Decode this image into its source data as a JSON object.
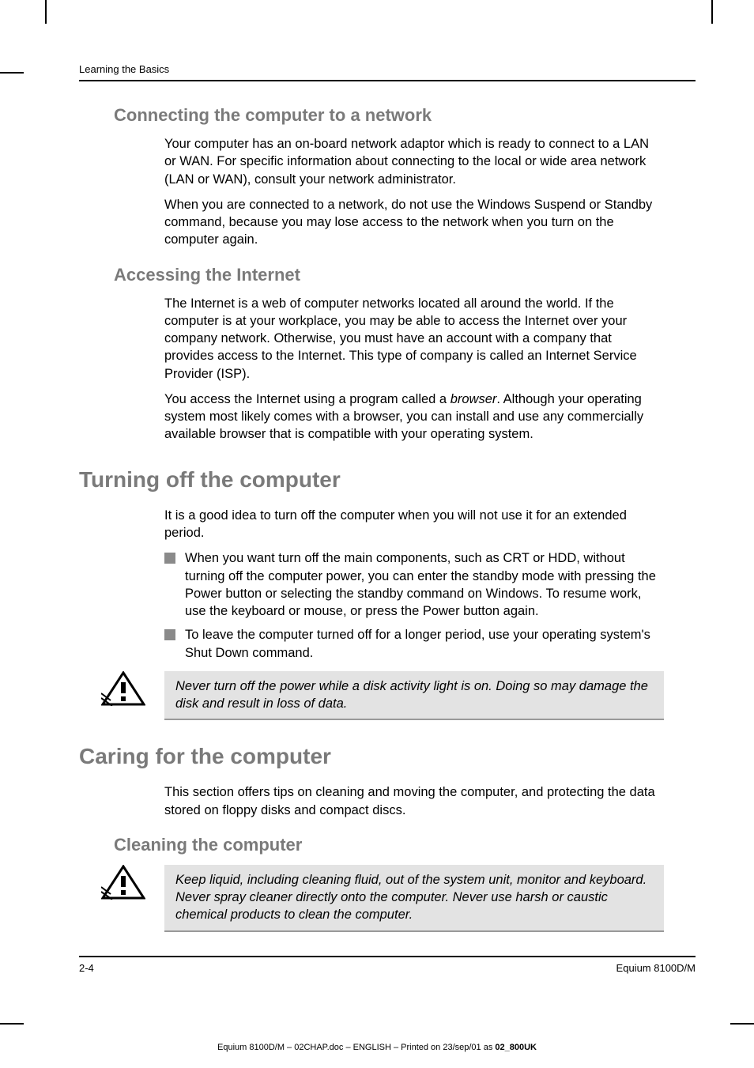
{
  "running_head": "Learning the Basics",
  "sections": {
    "s1": {
      "title": "Connecting the computer to a network",
      "p1": "Your computer has an on-board network adaptor which is ready to connect to a LAN or WAN. For specific information about connecting to the local or wide area network (LAN or WAN), consult your network administrator.",
      "p2": "When you are connected to a network, do not use the Windows Suspend or Standby command, because you may lose access to the network when you turn on the computer again."
    },
    "s2": {
      "title": "Accessing the Internet",
      "p1": "The Internet is a web of computer networks located all around the world. If the computer is at your workplace, you may be able to access the Internet over your company network. Otherwise, you must have an account with a company that provides access to the Internet. This type of company is called an Internet Service Provider (ISP).",
      "p2a": "You access the Internet using a program called a ",
      "p2b": "browser",
      "p2c": ". Although your operating system most likely comes with a browser, you can install and use any commercially available browser that is compatible with your operating system."
    },
    "s3": {
      "title": "Turning off the computer",
      "p1": "It is a good idea to turn off the computer when you will not use it for an extended period.",
      "b1": "When you want turn off the main components, such as CRT or HDD, without turning off the computer power, you can enter the standby mode with pressing the Power button or selecting the standby command on Windows. To resume work, use the keyboard or mouse, or press the Power button again.",
      "b2": "To leave the computer turned off for a longer period, use your operating system's Shut Down command.",
      "warn": "Never turn off the power while a disk activity light is on. Doing so may damage the disk and result in loss of data."
    },
    "s4": {
      "title": "Caring for the computer",
      "p1": "This section offers tips on cleaning and moving the computer, and protecting the data stored on floppy disks and compact discs."
    },
    "s5": {
      "title": "Cleaning the computer",
      "warn": "Keep liquid, including cleaning fluid, out of the system unit, monitor and keyboard. Never spray cleaner directly onto the computer. Never use harsh or caustic chemical products to clean the computer."
    }
  },
  "footer": {
    "page": "2-4",
    "model": "Equium 8100D/M"
  },
  "footer_line_a": "Equium 8100D/M  – 02CHAP.doc – ENGLISH – Printed on 23/sep/01 as ",
  "footer_line_b": "02_800UK"
}
